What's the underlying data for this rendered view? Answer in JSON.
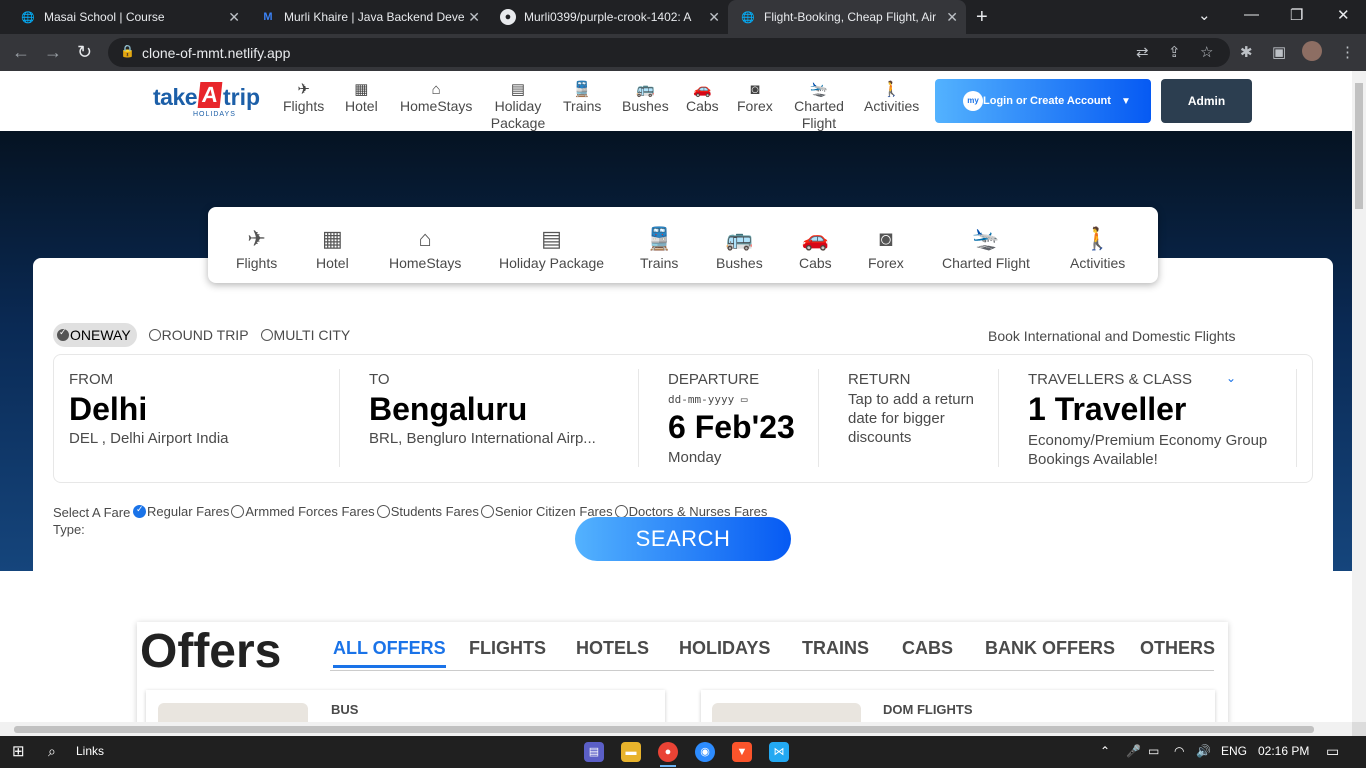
{
  "browser": {
    "tabs": [
      {
        "title": "Masai School | Course",
        "icon": "globe-icon"
      },
      {
        "title": "Murli Khaire | Java Backend Deve",
        "icon": "profile-logo-icon"
      },
      {
        "title": "Murli0399/purple-crook-1402: A",
        "icon": "github-icon"
      },
      {
        "title": "Flight-Booking, Cheap Flight, Air",
        "icon": "globe-icon"
      }
    ],
    "url": "clone-of-mmt.netlify.app"
  },
  "site": {
    "logo_take": "take",
    "logo_a": "A",
    "logo_trip": "trip",
    "logo_sub": "HOLIDAYS",
    "nav": [
      {
        "label": "Flights",
        "icon": "flight-icon"
      },
      {
        "label": "Hotel",
        "icon": "hotel-icon"
      },
      {
        "label": "HomeStays",
        "icon": "home-icon"
      },
      {
        "label": "Holiday Package",
        "icon": "holiday-icon"
      },
      {
        "label": "Trains",
        "icon": "train-icon"
      },
      {
        "label": "Bushes",
        "icon": "bus-icon"
      },
      {
        "label": "Cabs",
        "icon": "cab-icon"
      },
      {
        "label": "Forex",
        "icon": "camera-icon"
      },
      {
        "label": "Charted Flight",
        "icon": "landing-icon"
      },
      {
        "label": "Activities",
        "icon": "hiking-icon"
      }
    ],
    "login_label": "Login or Create Account",
    "login_badge": "my",
    "admin_label": "Admin"
  },
  "categories": [
    {
      "label": "Flights",
      "icon": "flight-icon"
    },
    {
      "label": "Hotel",
      "icon": "hotel-icon"
    },
    {
      "label": "HomeStays",
      "icon": "home-icon"
    },
    {
      "label": "Holiday Package",
      "icon": "holiday-icon"
    },
    {
      "label": "Trains",
      "icon": "train-icon"
    },
    {
      "label": "Bushes",
      "icon": "bus-icon"
    },
    {
      "label": "Cabs",
      "icon": "cab-icon"
    },
    {
      "label": "Forex",
      "icon": "camera-icon"
    },
    {
      "label": "Charted Flight",
      "icon": "landing-icon"
    },
    {
      "label": "Activities",
      "icon": "hiking-icon"
    }
  ],
  "trip_types": {
    "oneway": "ONEWAY",
    "roundtrip": "ROUND TRIP",
    "multicity": "MULTI CITY",
    "selected": "ONEWAY"
  },
  "book_intl": "Book International and Domestic Flights",
  "search": {
    "from_label": "FROM",
    "from_city": "Delhi",
    "from_sub": "DEL , Delhi Airport India",
    "to_label": "TO",
    "to_city": "Bengaluru",
    "to_sub": "BRL, Bengluro International Airp...",
    "departure_label": "DEPARTURE",
    "date_placeholder": "dd-mm-yyyy",
    "departure_date": "6 Feb'23",
    "departure_day": "Monday",
    "return_label": "RETURN",
    "return_text": "Tap to add a return date for bigger discounts",
    "travellers_label": "TRAVELLERS & CLASS",
    "travellers_value": "1 Traveller",
    "travellers_sub": "Economy/Premium Economy Group Bookings Available!"
  },
  "fare_type": {
    "label": "Select A Fare Type:",
    "options": [
      "Regular Fares",
      "Armmed Forces Fares",
      "Students Fares",
      "Senior Citizen Fares",
      "Doctors & Nurses Fares"
    ],
    "selected": "Regular Fares"
  },
  "search_button": "SEARCH",
  "offers": {
    "title": "Offers",
    "tabs": [
      "ALL OFFERS",
      "FLIGHTS",
      "HOTELS",
      "HOLIDAYS",
      "TRAINS",
      "CABS",
      "BANK OFFERS",
      "OTHERS"
    ],
    "active_tab": "ALL OFFERS",
    "cards": [
      {
        "tag": "BUS"
      },
      {
        "tag": "DOM FLIGHTS"
      }
    ]
  },
  "taskbar": {
    "search_label": "Links",
    "lang": "ENG",
    "time": "02:16 PM"
  },
  "colors": {
    "accent": "#1a73e8",
    "brand_red": "#e8262b",
    "hero_dark": "#051322",
    "admin_bg": "#2c3e50"
  }
}
